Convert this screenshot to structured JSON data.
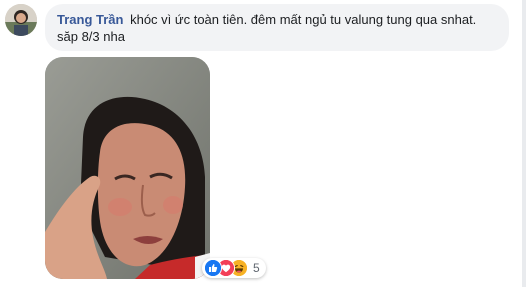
{
  "comment": {
    "author": "Trang Trần",
    "text": "khóc vì ức toàn tiên. đêm mất ngủ tu valung tung qua snhat. săp 8/3 nha",
    "reactions": {
      "icons": [
        "like-icon",
        "love-icon",
        "haha-icon"
      ],
      "count": "5"
    }
  },
  "colors": {
    "author_link": "#385898",
    "bubble_bg": "#f2f3f5",
    "like_blue": "#1877f2",
    "love_red": "#f33e58",
    "haha_yellow": "#f7b125"
  }
}
